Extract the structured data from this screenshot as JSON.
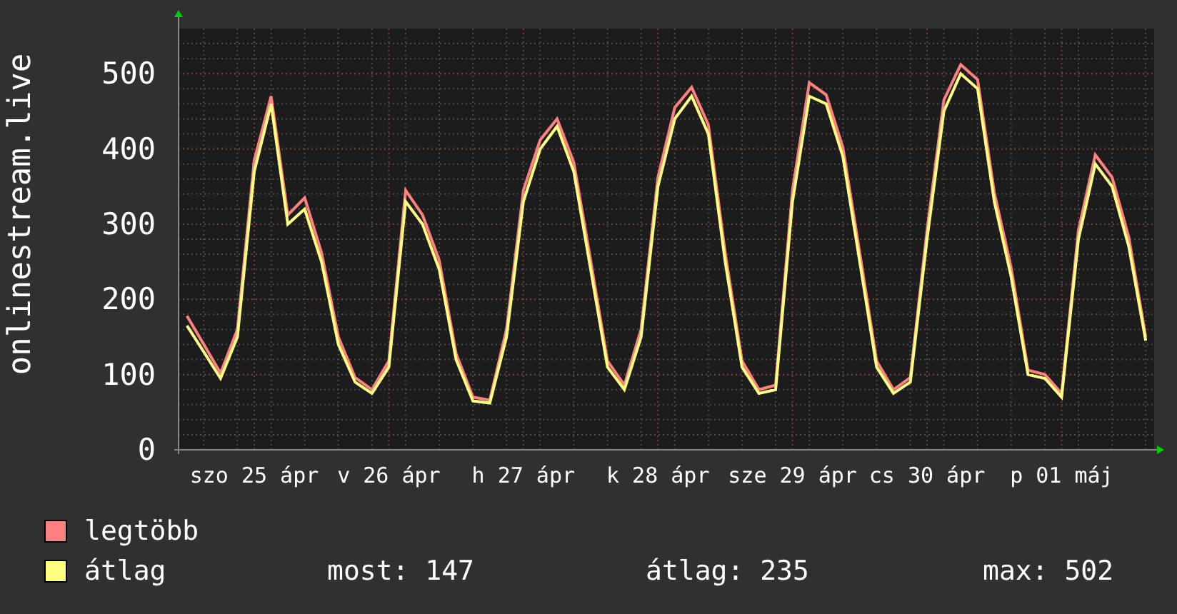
{
  "chart": {
    "chart_data": {
      "type": "line",
      "grid": true,
      "ylabel": "onlinestream.live",
      "ylim": [
        0,
        560
      ],
      "yticks": [
        0,
        100,
        200,
        300,
        400,
        500
      ],
      "categories": [
        null,
        null,
        null,
        null,
        "szo 25 ápr",
        null,
        null,
        null,
        null,
        null,
        null,
        null,
        "v 26 ápr",
        null,
        null,
        null,
        null,
        null,
        null,
        null,
        "h 27 ápr",
        null,
        null,
        null,
        null,
        null,
        null,
        null,
        "k 28 ápr",
        null,
        null,
        null,
        null,
        null,
        null,
        null,
        "sze 29 ápr",
        null,
        null,
        null,
        null,
        null,
        null,
        null,
        "cs 30 ápr",
        null,
        null,
        null,
        null,
        null,
        null,
        null,
        "p 01 máj",
        null,
        null,
        null,
        null,
        null
      ],
      "series": [
        {
          "name": "legtöbb",
          "color": "#ff8080",
          "values": [
            178,
            140,
            102,
            160,
            385,
            470,
            312,
            335,
            262,
            150,
            96,
            80,
            118,
            345,
            312,
            252,
            128,
            70,
            66,
            160,
            345,
            412,
            440,
            382,
            252,
            118,
            86,
            160,
            362,
            455,
            482,
            432,
            262,
            118,
            80,
            86,
            345,
            488,
            472,
            402,
            262,
            118,
            80,
            96,
            292,
            465,
            512,
            492,
            342,
            242,
            106,
            100,
            75,
            292,
            392,
            362,
            282,
            150
          ]
        },
        {
          "name": "átlag",
          "color": "#ffff80",
          "values": [
            165,
            130,
            95,
            150,
            370,
            460,
            300,
            320,
            250,
            140,
            90,
            75,
            110,
            330,
            300,
            240,
            120,
            65,
            62,
            150,
            330,
            400,
            430,
            370,
            240,
            110,
            80,
            150,
            350,
            440,
            470,
            420,
            250,
            110,
            75,
            80,
            330,
            470,
            460,
            390,
            250,
            110,
            75,
            90,
            280,
            450,
            500,
            480,
            330,
            230,
            100,
            95,
            70,
            280,
            380,
            350,
            270,
            145
          ]
        }
      ]
    }
  },
  "legend_stats": [
    "most: 147",
    "átlag: 235",
    "max: 502"
  ]
}
